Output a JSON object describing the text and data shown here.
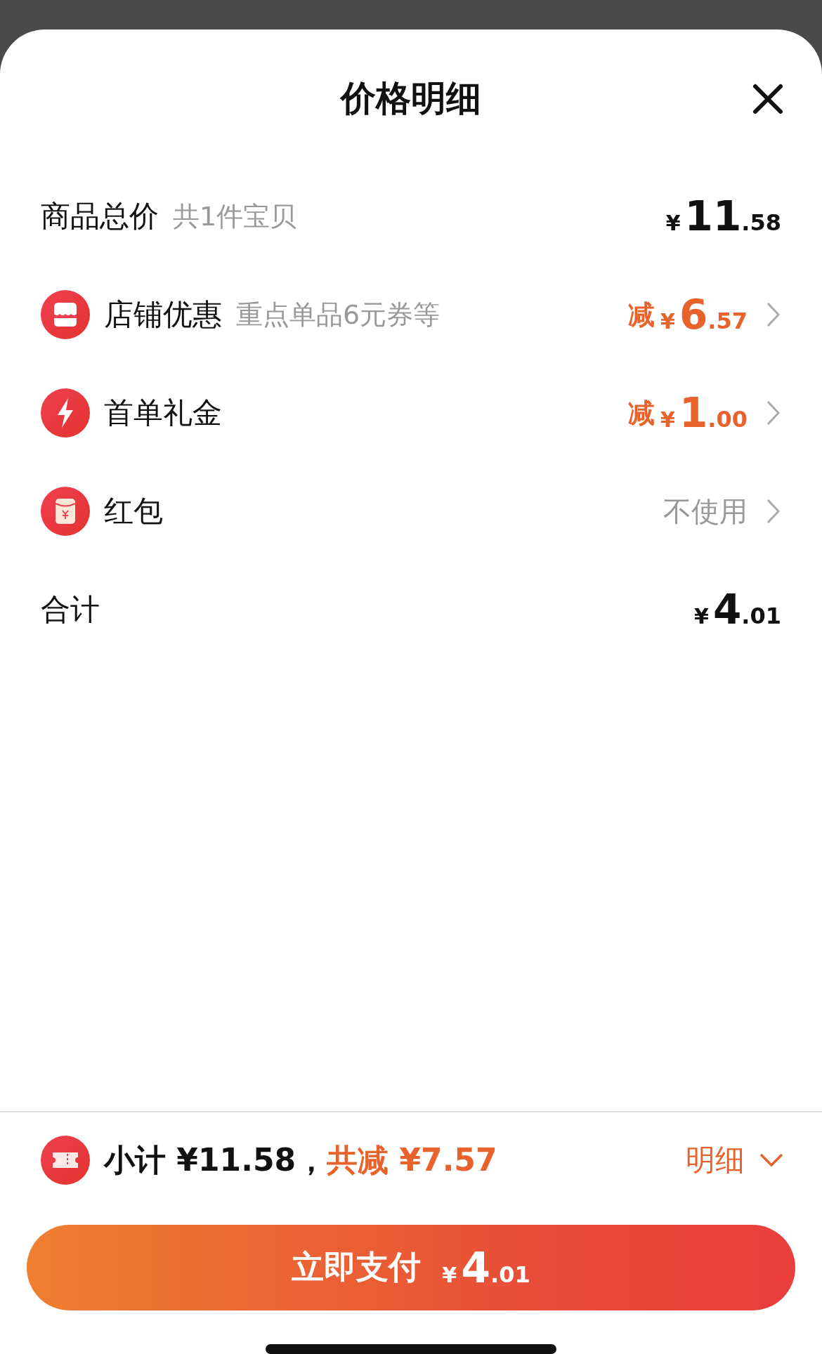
{
  "sheet": {
    "title": "价格明细"
  },
  "rows": [
    {
      "kind": "total",
      "label": "商品总价",
      "note": "共1件宝贝",
      "price": {
        "currency": "¥",
        "integer": "11",
        "decimal": ".58"
      }
    },
    {
      "kind": "discount",
      "label": "店铺优惠",
      "note": "重点单品6元券等",
      "prefix": "减",
      "price": {
        "currency": "¥",
        "integer": "6",
        "decimal": ".57"
      }
    },
    {
      "kind": "discount",
      "label": "首单礼金",
      "prefix": "减",
      "price": {
        "currency": "¥",
        "integer": "1",
        "decimal": ".00"
      }
    },
    {
      "kind": "option",
      "label": "红包",
      "value": "不使用"
    },
    {
      "kind": "total",
      "label": "合计",
      "price": {
        "currency": "¥",
        "integer": "4",
        "decimal": ".01"
      }
    }
  ],
  "summary": {
    "subtotal": "小计 ¥11.58，",
    "saved": "共减 ¥7.57",
    "details_link": "明细"
  },
  "pay_button": {
    "label": "立即支付",
    "price": {
      "currency": "¥",
      "integer": "4",
      "decimal": ".01"
    }
  }
}
